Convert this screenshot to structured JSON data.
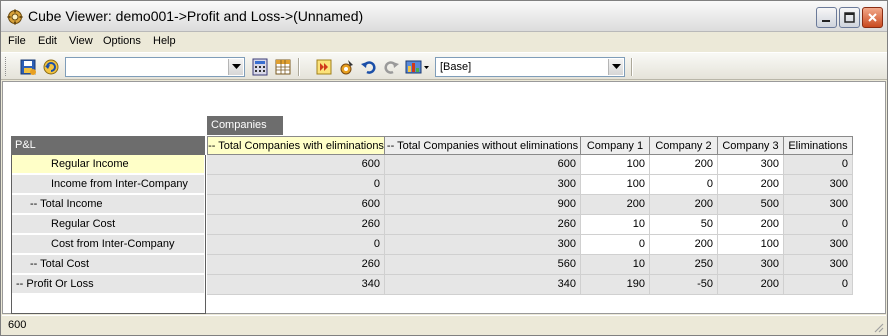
{
  "window": {
    "title": "Cube Viewer: demo001->Profit and Loss->(Unnamed)"
  },
  "menu": [
    {
      "label": "File"
    },
    {
      "label": "Edit"
    },
    {
      "label": "View"
    },
    {
      "label": "Options"
    },
    {
      "label": "Help"
    }
  ],
  "toolbar": {
    "view_combo_value": "",
    "subset_combo_value": "[Base]",
    "icons": [
      "save-view-icon",
      "recalculate-icon",
      "calculator-icon",
      "spreadsheet-icon",
      "export-icon",
      "sandbox-icon",
      "undo-icon",
      "redo-icon",
      "chart-icon"
    ]
  },
  "grid": {
    "column_dimension": "Companies",
    "row_dimension": "P&L",
    "columns": [
      "-- Total Companies with eliminations",
      "-- Total Companies without eliminations",
      "Company 1",
      "Company 2",
      "Company 3",
      "Eliminations"
    ],
    "rows": [
      {
        "label": "Regular Income",
        "indent": 2,
        "values": [
          "600",
          "600",
          "100",
          "200",
          "300",
          "0"
        ]
      },
      {
        "label": "Income from Inter-Company",
        "indent": 2,
        "values": [
          "0",
          "300",
          "100",
          "0",
          "200",
          "300"
        ]
      },
      {
        "label": "-- Total Income",
        "indent": 1,
        "values": [
          "600",
          "900",
          "200",
          "200",
          "500",
          "300"
        ]
      },
      {
        "label": "Regular Cost",
        "indent": 2,
        "values": [
          "260",
          "260",
          "10",
          "50",
          "200",
          "0"
        ]
      },
      {
        "label": "Cost from Inter-Company",
        "indent": 2,
        "values": [
          "0",
          "300",
          "0",
          "200",
          "100",
          "300"
        ]
      },
      {
        "label": "-- Total Cost",
        "indent": 1,
        "values": [
          "260",
          "560",
          "10",
          "250",
          "300",
          "300"
        ]
      },
      {
        "label": "-- Profit Or Loss",
        "indent": 0,
        "values": [
          "340",
          "340",
          "190",
          "-50",
          "200",
          "0"
        ]
      }
    ]
  },
  "status": {
    "text": "600"
  },
  "colors": {
    "dim_tab": "#6d6d6d",
    "selected_cell": "#ffffc8",
    "calc_cell": "#e6e6e6"
  }
}
